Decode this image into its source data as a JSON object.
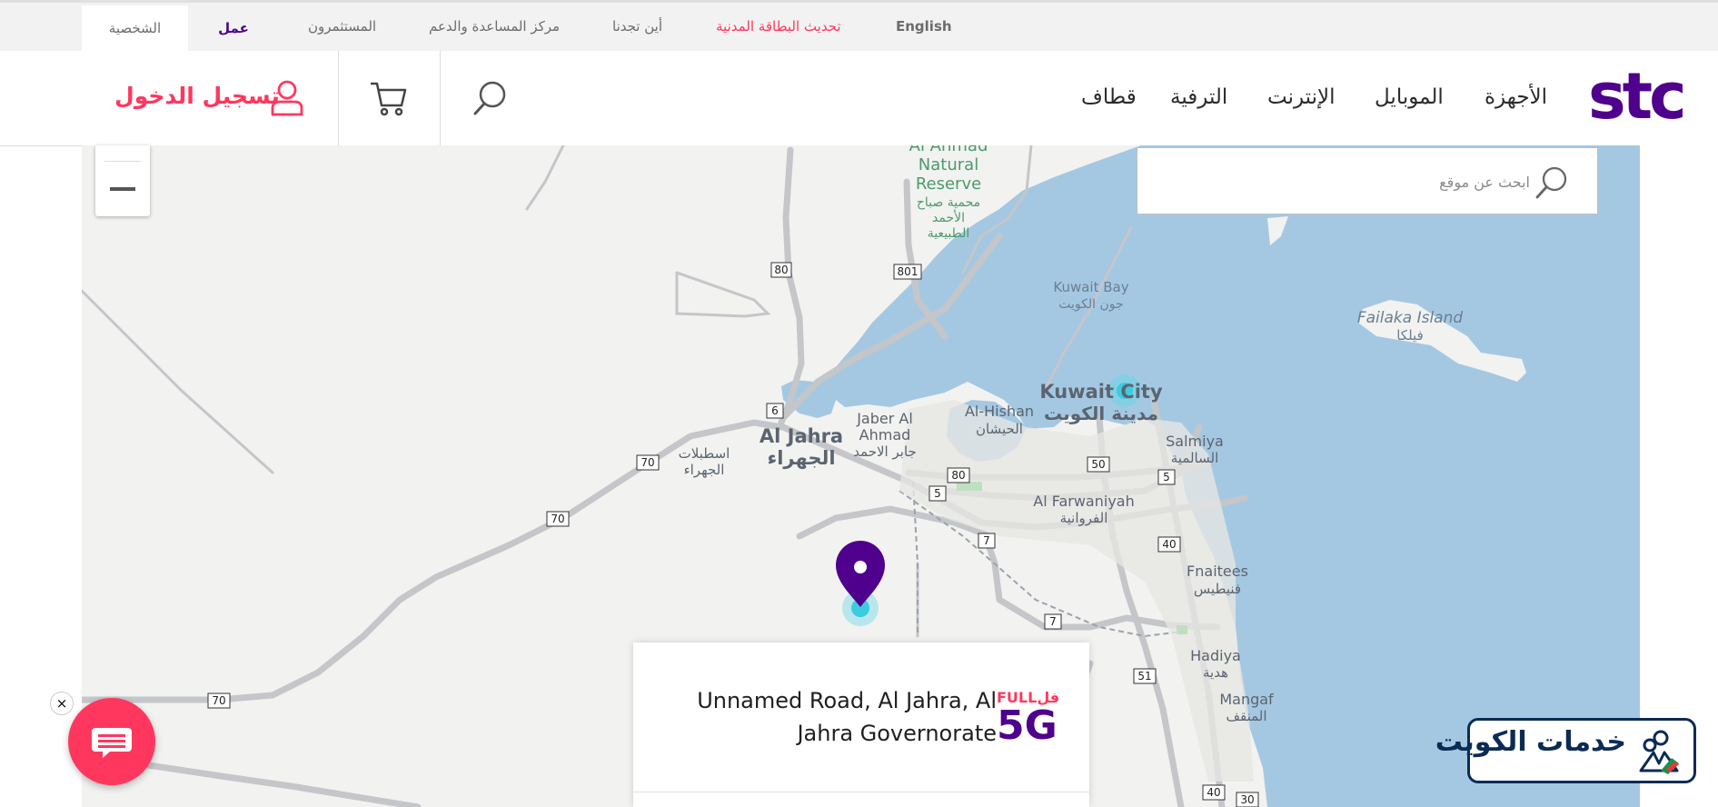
{
  "topbar": {
    "tab_personal": "الشخصية",
    "tab_business": "عمل",
    "investors": "المستثمرون",
    "help_support": "مركز المساعدة والدعم",
    "find_us": "أين تجدنا",
    "update_civil_id": "تحديث البطاقة المدنية",
    "language": "English"
  },
  "header": {
    "logo": "stc",
    "nav": [
      "الأجهزة",
      "الموبايل",
      "الإنترنت",
      "الترفية",
      "قطاف"
    ],
    "login_label": "تسجيل الدخول",
    "icons": {
      "search": "search-icon",
      "cart": "cart-icon",
      "user": "user-icon"
    }
  },
  "map": {
    "search_placeholder": "ابحث عن موقع",
    "zoom_out_icon": "minus-icon",
    "labels": {
      "reserve_en_1": "Al Ahmad",
      "reserve_en_2": "Natural",
      "reserve_en_3": "Reserve",
      "reserve_ar_1": "محمية صباح",
      "reserve_ar_2": "الأحمد",
      "reserve_ar_3": "الطبيعية",
      "kuwait_bay_en": "Kuwait Bay",
      "kuwait_bay_ar": "جون الكويت",
      "failaka_en": "Failaka Island",
      "failaka_ar": "فيلكا",
      "kuwait_city_en": "Kuwait City",
      "kuwait_city_ar": "مدينة الكويت",
      "jahra_en": "Al Jahra",
      "jahra_ar": "الجهراء",
      "jaber_en_1": "Jaber Al",
      "jaber_en_2": "Ahmad",
      "jaber_ar": "جابر الاحمد",
      "hisham_en": "Al-Hishan",
      "hisham_ar": "الحيشان",
      "salmiya_en": "Salmiya",
      "salmiya_ar": "السالمية",
      "farwaniyah_en": "Al Farwaniyah",
      "farwaniyah_ar": "الفروانية",
      "istablat_ar_1": "اسطبلات",
      "istablat_ar_2": "الجهراء",
      "fnaitees_en": "Fnaitees",
      "fnaitees_ar": "فنيطيس",
      "hadiya_en": "Hadiya",
      "hadiya_ar": "هدية",
      "mangaf_en": "Mangaf",
      "mangaf_ar": "المنقف"
    },
    "road_shields": [
      "80",
      "801",
      "6",
      "70",
      "70",
      "70",
      "80",
      "5",
      "50",
      "5",
      "40",
      "7",
      "7",
      "51",
      "40",
      "30"
    ],
    "colors": {
      "land": "#f2f2f0",
      "water": "#a5c8e2",
      "road": "#c4c6c9",
      "pin": "#4f008c",
      "accent": "#ff375e"
    }
  },
  "infocard": {
    "address_line1": "Unnamed Road, Al Jahra, Al",
    "address_line2": "Jahra Governorate",
    "badge_full": "FULLفل",
    "badge_5g": "5G"
  },
  "chat": {
    "close": "×"
  },
  "watermark": {
    "text": "خدمات الكويت"
  }
}
